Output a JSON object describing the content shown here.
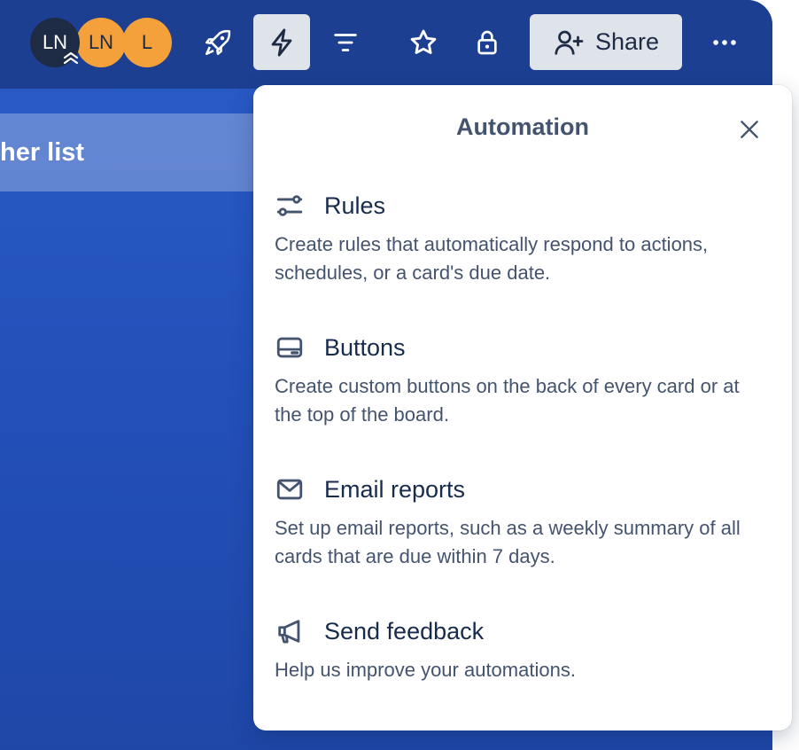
{
  "header": {
    "members": [
      {
        "initials": "LN",
        "color": "#1e2b45"
      },
      {
        "initials": "LN",
        "color": "#f4a13b"
      },
      {
        "initials": "L",
        "color": "#f4a13b"
      }
    ],
    "icons": [
      "rocket-icon",
      "lightning-icon",
      "filter-icon",
      "star-icon",
      "lock-icon"
    ],
    "share_label": "Share",
    "more_icon": "more-icon"
  },
  "list": {
    "title_fragment": "her list"
  },
  "automation_popover": {
    "title": "Automation",
    "items": [
      {
        "title": "Rules",
        "description": "Create rules that automatically respond to actions, schedules, or a card's due date.",
        "icon": "sliders-icon"
      },
      {
        "title": "Buttons",
        "description": "Create custom buttons on the back of every card or at the top of the board.",
        "icon": "card-button-icon"
      },
      {
        "title": "Email reports",
        "description": "Set up email reports, such as a weekly summary of all cards that are due within 7 days.",
        "icon": "envelope-icon"
      },
      {
        "title": "Send feedback",
        "description": "Help us improve your automations.",
        "icon": "megaphone-icon"
      }
    ]
  },
  "colors": {
    "board_blue": "#2250b8",
    "header_blue": "#1c3f92",
    "text_dark": "#172b4d",
    "text_subtle": "#44546f"
  }
}
